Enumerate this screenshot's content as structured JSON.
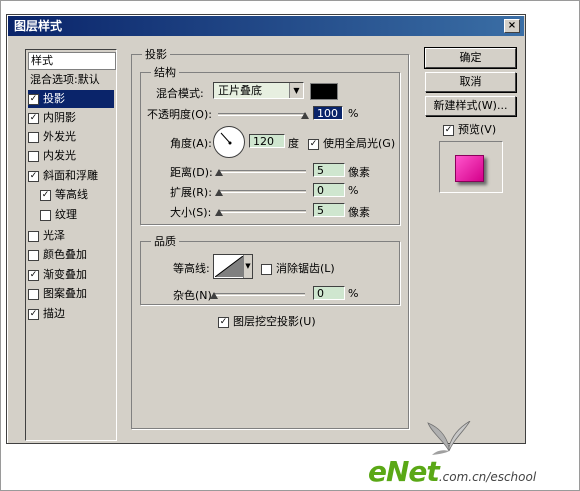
{
  "window": {
    "title": "图层样式",
    "close_glyph": "×"
  },
  "sidebar": {
    "header": "样式",
    "items": [
      {
        "label": "混合选项:默认",
        "checkbox": false
      },
      {
        "label": "投影",
        "checkbox": true,
        "checked": true,
        "selected": true
      },
      {
        "label": "内阴影",
        "checkbox": true,
        "checked": true
      },
      {
        "label": "外发光",
        "checkbox": true,
        "checked": false
      },
      {
        "label": "内发光",
        "checkbox": true,
        "checked": false
      },
      {
        "label": "斜面和浮雕",
        "checkbox": true,
        "checked": true
      },
      {
        "label": "等高线",
        "checkbox": true,
        "checked": true,
        "indent": true
      },
      {
        "label": "纹理",
        "checkbox": true,
        "checked": false,
        "indent": true
      },
      {
        "label": "光泽",
        "checkbox": true,
        "checked": false
      },
      {
        "label": "颜色叠加",
        "checkbox": true,
        "checked": false
      },
      {
        "label": "渐变叠加",
        "checkbox": true,
        "checked": true
      },
      {
        "label": "图案叠加",
        "checkbox": true,
        "checked": false
      },
      {
        "label": "描边",
        "checkbox": true,
        "checked": true
      }
    ]
  },
  "shadow": {
    "group_title": "投影",
    "structure": {
      "title": "结构",
      "blend_mode_label": "混合模式:",
      "blend_mode_value": "正片叠底",
      "swatch_color": "#000000",
      "opacity_label": "不透明度(O):",
      "opacity_value": "100",
      "opacity_unit": "%",
      "opacity_level": 1.0,
      "angle_label": "角度(A):",
      "angle_value": "120",
      "angle_unit": "度",
      "global_light_label": "使用全局光(G)",
      "global_light_checked": true,
      "distance_label": "距离(D):",
      "distance_value": "5",
      "distance_unit": "像素",
      "spread_label": "扩展(R):",
      "spread_value": "0",
      "spread_unit": "%",
      "size_label": "大小(S):",
      "size_value": "5",
      "size_unit": "像素"
    },
    "quality": {
      "title": "品质",
      "contour_label": "等高线:",
      "anti_alias_label": "消除锯齿(L)",
      "anti_alias_checked": false,
      "noise_label": "杂色(N):",
      "noise_value": "0",
      "noise_unit": "%"
    },
    "knockout_label": "图层挖空投影(U)",
    "knockout_checked": true
  },
  "buttons": {
    "ok": "确定",
    "cancel": "取消",
    "new_style": "新建样式(W)..."
  },
  "preview": {
    "label": "预览(V)",
    "checked": true,
    "swatch_color": "#e6199e"
  },
  "watermark": {
    "logo": "eNet",
    "url": ".com.cn/eschool"
  },
  "colors": {
    "title_start": "#0a246a",
    "title_end": "#3a6ea5",
    "dialog_bg": "#d4d0c8",
    "field_bg": "#cfe6cf"
  }
}
